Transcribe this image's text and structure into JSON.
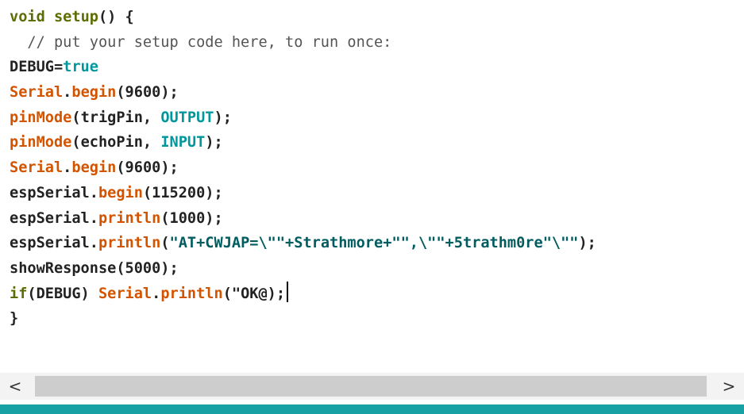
{
  "editor": {
    "lines": [
      [
        {
          "t": "void",
          "c": "keyword"
        },
        {
          "t": " ",
          "c": "plain"
        },
        {
          "t": "setup",
          "c": "keyword"
        },
        {
          "t": "() {",
          "c": "plain"
        }
      ],
      [
        {
          "t": "  // put your setup code here, to run once:",
          "c": "comment"
        }
      ],
      [
        {
          "t": "DEBUG=",
          "c": "plain"
        },
        {
          "t": "true",
          "c": "const"
        }
      ],
      [
        {
          "t": "Serial",
          "c": "func"
        },
        {
          "t": ".",
          "c": "plain"
        },
        {
          "t": "begin",
          "c": "func"
        },
        {
          "t": "(9600);",
          "c": "plain"
        }
      ],
      [
        {
          "t": "pinMode",
          "c": "func"
        },
        {
          "t": "(trigPin, ",
          "c": "plain"
        },
        {
          "t": "OUTPUT",
          "c": "const"
        },
        {
          "t": ");",
          "c": "plain"
        }
      ],
      [
        {
          "t": "pinMode",
          "c": "func"
        },
        {
          "t": "(echoPin, ",
          "c": "plain"
        },
        {
          "t": "INPUT",
          "c": "const"
        },
        {
          "t": ");",
          "c": "plain"
        }
      ],
      [
        {
          "t": "Serial",
          "c": "func"
        },
        {
          "t": ".",
          "c": "plain"
        },
        {
          "t": "begin",
          "c": "func"
        },
        {
          "t": "(9600);",
          "c": "plain"
        }
      ],
      [
        {
          "t": "espSerial.",
          "c": "plain"
        },
        {
          "t": "begin",
          "c": "func"
        },
        {
          "t": "(115200);",
          "c": "plain"
        }
      ],
      [
        {
          "t": "espSerial.",
          "c": "plain"
        },
        {
          "t": "println",
          "c": "func"
        },
        {
          "t": "(1000);",
          "c": "plain"
        }
      ],
      [
        {
          "t": "espSerial.",
          "c": "plain"
        },
        {
          "t": "println",
          "c": "func"
        },
        {
          "t": "(",
          "c": "plain"
        },
        {
          "t": "\"AT+CWJAP=\\\"\"+Strathmore+\"\",\\\"\"+5trathm0re\"\\\"\"",
          "c": "string"
        },
        {
          "t": ");",
          "c": "plain"
        }
      ],
      [
        {
          "t": "showResponse(5000);",
          "c": "plain"
        }
      ],
      [
        {
          "t": "if",
          "c": "keyword"
        },
        {
          "t": "(DEBUG) ",
          "c": "plain"
        },
        {
          "t": "Serial",
          "c": "func"
        },
        {
          "t": ".",
          "c": "plain"
        },
        {
          "t": "println",
          "c": "func"
        },
        {
          "t": "(\"OK@);",
          "c": "plain"
        }
      ],
      [
        {
          "t": "}",
          "c": "plain"
        }
      ]
    ],
    "caret_line": 11,
    "colors": {
      "keyword": "#5e6d03",
      "function": "#d35400",
      "constant": "#00979c",
      "comment": "#555555",
      "status_bar": "#17a1a5"
    }
  },
  "scrollbar": {
    "left_arrow": "<",
    "right_arrow": ">",
    "left_icon": "chevron-left-icon",
    "right_icon": "chevron-right-icon"
  }
}
